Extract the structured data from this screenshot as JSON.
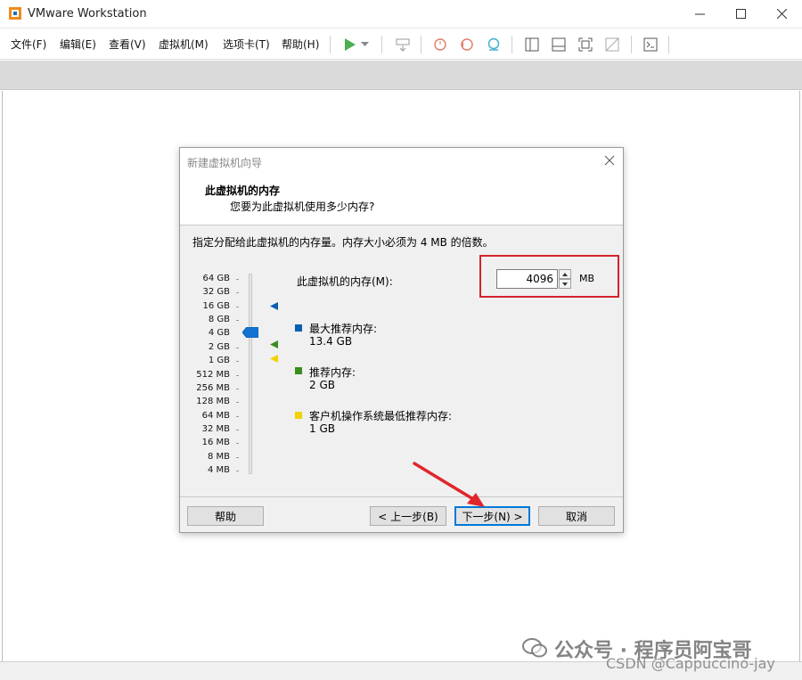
{
  "window": {
    "title": "VMware Workstation"
  },
  "menu": {
    "items": [
      "文件(F)",
      "编辑(E)",
      "查看(V)",
      "虚拟机(M)",
      "选项卡(T)",
      "帮助(H)"
    ]
  },
  "dialog": {
    "title": "新建虚拟机向导",
    "header_title": "此虚拟机的内存",
    "header_subtitle": "您要为此虚拟机使用多少内存?",
    "instruction": "指定分配给此虚拟机的内存量。内存大小必须为 4 MB 的倍数。",
    "memory_label": "此虚拟机的内存(M):",
    "memory_value": "4096",
    "memory_unit": "MB",
    "scale_labels": [
      "64 GB",
      "32 GB",
      "16 GB",
      "8 GB",
      "4 GB",
      "2 GB",
      "1 GB",
      "512 MB",
      "256 MB",
      "128 MB",
      "64 MB",
      "32 MB",
      "16 MB",
      "8 MB",
      "4 MB"
    ],
    "legend": [
      {
        "title": "最大推荐内存:",
        "value": "13.4 GB",
        "color": "#0b5fb0"
      },
      {
        "title": "推荐内存:",
        "value": "2 GB",
        "color": "#3a8e1e"
      },
      {
        "title": "客户机操作系统最低推荐内存:",
        "value": "1 GB",
        "color": "#f2d200"
      }
    ],
    "buttons": {
      "help": "帮助",
      "back": "< 上一步(B)",
      "next": "下一步(N) >",
      "cancel": "取消"
    }
  },
  "watermark": {
    "text": "公众号 · 程序员阿宝哥",
    "csdn": "CSDN @Cappuccino-jay"
  }
}
